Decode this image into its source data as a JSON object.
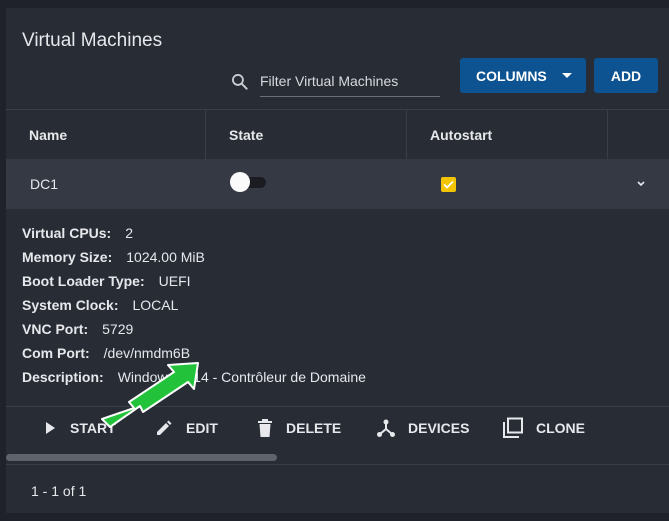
{
  "page": {
    "title": "Virtual Machines"
  },
  "toolbar": {
    "search_placeholder": "Filter Virtual Machines",
    "columns_label": "COLUMNS",
    "add_label": "ADD"
  },
  "table": {
    "headers": [
      "Name",
      "State",
      "Autostart"
    ],
    "row": {
      "name": "DC1",
      "state_on": false,
      "autostart": true
    }
  },
  "details": [
    {
      "label": "Virtual CPUs:",
      "value": "2"
    },
    {
      "label": "Memory Size:",
      "value": "1024.00 MiB"
    },
    {
      "label": "Boot Loader Type:",
      "value": "UEFI"
    },
    {
      "label": "System Clock:",
      "value": "LOCAL"
    },
    {
      "label": "VNC Port:",
      "value": "5729"
    },
    {
      "label": "Com Port:",
      "value": "/dev/nmdm6B"
    },
    {
      "label": "Description:",
      "value": "Windows 2k14 - Contrôleur de Domaine"
    }
  ],
  "actions": {
    "start": "START",
    "edit": "EDIT",
    "delete": "DELETE",
    "devices": "DEVICES",
    "clone": "CLONE"
  },
  "footer": {
    "paging": "1 - 1 of 1"
  },
  "colors": {
    "background": "#1f222a",
    "panel": "#282c35",
    "row_highlight": "#343944",
    "button_primary": "#0d5391",
    "checkbox_checked": "#f2c500",
    "annotation_arrow": "#22c33a"
  },
  "icons": {
    "search": "search-icon",
    "expand": "chevron-down-icon",
    "start": "play-icon",
    "edit": "pencil-icon",
    "delete": "trash-icon",
    "devices": "devices-icon",
    "clone": "clone-icon",
    "annotation": "green-arrow-icon"
  }
}
